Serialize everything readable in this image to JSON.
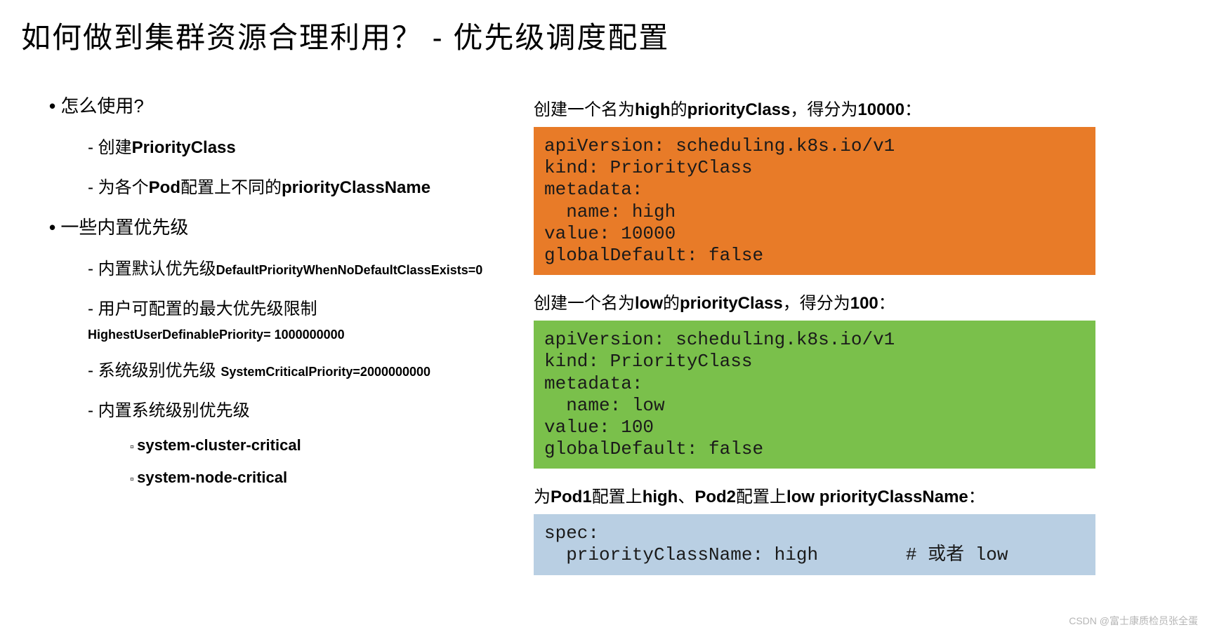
{
  "title": "如何做到集群资源合理利用？ - 优先级调度配置",
  "left": {
    "q_use": "怎么使用?",
    "create_pc_prefix": "创建",
    "create_pc_bold": "PriorityClass",
    "pod_prefix": "为各个",
    "pod_bold1": "Pod",
    "pod_mid": "配置上不同的",
    "pod_bold2": "priorityClassName",
    "builtin": "一些内置优先级",
    "default_prefix": "内置默认优先级",
    "default_code": "DefaultPriorityWhenNoDefaultClassExists=0",
    "user_max": "用户可配置的最大优先级限制",
    "user_max_code": "HighestUserDefinablePriority= 1000000000",
    "sys_level": "系统级别优先级",
    "sys_level_code": "SystemCriticalPriority=2000000000",
    "builtin_sys": "内置系统级别优先级",
    "scc": "system-cluster-critical",
    "snc": "system-node-critical"
  },
  "right": {
    "cap1_p1": "创建一个名为",
    "cap1_b1": "high",
    "cap1_p2": "的",
    "cap1_b2": "priorityClass",
    "cap1_p3": "，得分为",
    "cap1_b3": "10000",
    "cap1_p4": "：",
    "code1": "apiVersion: scheduling.k8s.io/v1\nkind: PriorityClass\nmetadata:\n  name: high\nvalue: 10000\nglobalDefault: false",
    "cap2_p1": "创建一个名为",
    "cap2_b1": "low",
    "cap2_p2": "的",
    "cap2_b2": "priorityClass",
    "cap2_p3": "，得分为",
    "cap2_b3": "100",
    "cap2_p4": "：",
    "code2": "apiVersion: scheduling.k8s.io/v1\nkind: PriorityClass\nmetadata:\n  name: low\nvalue: 100\nglobalDefault: false",
    "cap3_p1": "为",
    "cap3_b1": "Pod1",
    "cap3_p2": "配置上",
    "cap3_b2": "high",
    "cap3_p3": "、",
    "cap3_b3": "Pod2",
    "cap3_p4": "配置上",
    "cap3_b4": "low priorityClassName",
    "cap3_p5": "：",
    "code3": "spec:\n  priorityClassName: high        # 或者 low"
  },
  "watermark": "CSDN @富士康质检员张全蛋"
}
